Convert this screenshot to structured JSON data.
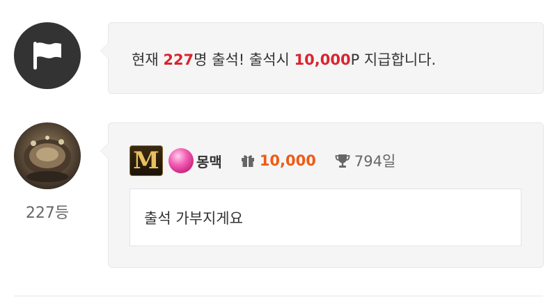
{
  "notice": {
    "prefix": "현재 ",
    "count": "227",
    "middle": "명 출석! 출석시 ",
    "points": "10,000",
    "suffix": "P 지급합니다."
  },
  "entry": {
    "rank": "227등",
    "level_letter": "M",
    "nickname": "몽맥",
    "points": "10,000",
    "days": "794일",
    "comment": "출석 가부지게요"
  },
  "colors": {
    "highlight_red": "#d9242f",
    "points_orange": "#ef5a16",
    "bubble_bg": "#f5f5f5",
    "flag_circle": "#333333"
  },
  "icons": [
    "flag-icon",
    "gift-icon",
    "trophy-icon"
  ]
}
